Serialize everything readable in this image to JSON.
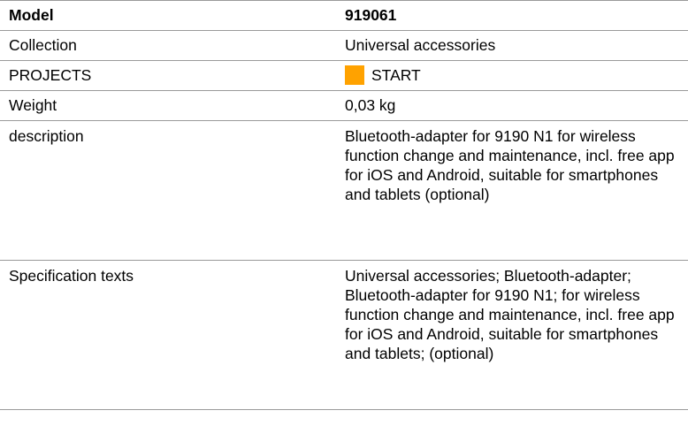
{
  "header": {
    "label": "Model",
    "value": "919061"
  },
  "rows": {
    "collection": {
      "label": "Collection",
      "value": "Universal accessories"
    },
    "projects": {
      "label": "PROJECTS",
      "value": "START",
      "swatch_color": "#ffa200"
    },
    "weight": {
      "label": "Weight",
      "value": "0,03 kg"
    },
    "description": {
      "label": "description",
      "value": "Bluetooth-adapter for 9190 N1 for wireless function change and maintenance, incl. free app for iOS and Android, suitable for smartphones and tablets (optional)"
    },
    "specification": {
      "label": "Specification texts",
      "value": "Universal accessories; Bluetooth-adapter; Bluetooth-adapter for 9190 N1; for wireless function change and maintenance, incl. free app for iOS and Android, suitable for smartphones and tablets; (optional)"
    }
  }
}
